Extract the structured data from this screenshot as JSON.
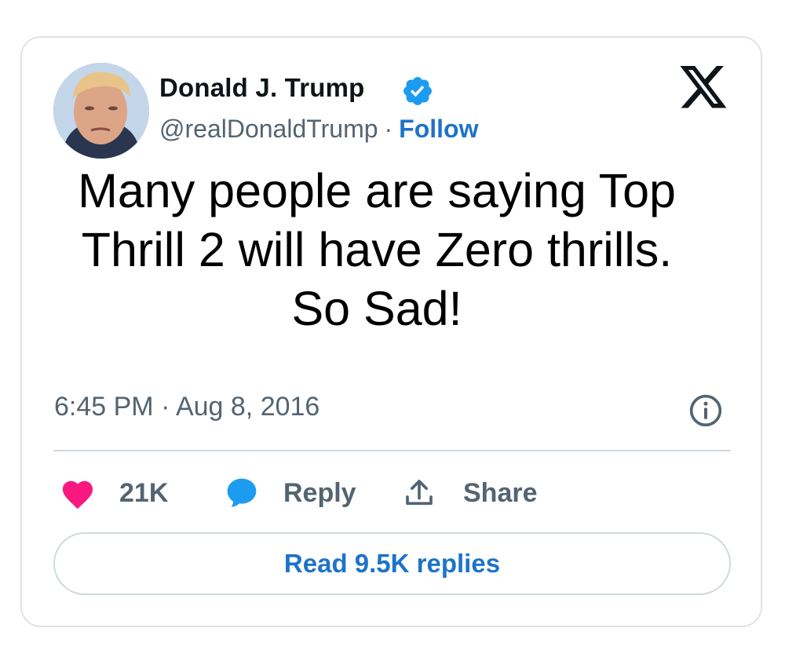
{
  "tweet": {
    "author": {
      "name": "Donald J. Trump",
      "handle": "@realDonaldTrump",
      "separator": "·",
      "follow_label": "Follow",
      "avatar_icon": "profile-photo",
      "verified_icon": "verified-badge-icon"
    },
    "platform_icon": "x-logo-icon",
    "text_lines": [
      "Many people are saying Top",
      "Thrill 2 will have Zero thrills.",
      "So Sad!"
    ],
    "timestamp": "6:45 PM · Aug 8, 2016",
    "info_icon": "info-icon",
    "actions": {
      "like_count": "21K",
      "like_icon": "heart-icon",
      "reply_label": "Reply",
      "reply_icon": "speech-bubble-icon",
      "share_label": "Share",
      "share_icon": "share-upload-icon"
    },
    "read_replies_label": "Read 9.5K replies"
  },
  "colors": {
    "link_blue": "#1d73c9",
    "verified_blue": "#1d9bf0",
    "heart_pink": "#f91880",
    "muted_text": "#536471",
    "border": "#cfd9de"
  }
}
